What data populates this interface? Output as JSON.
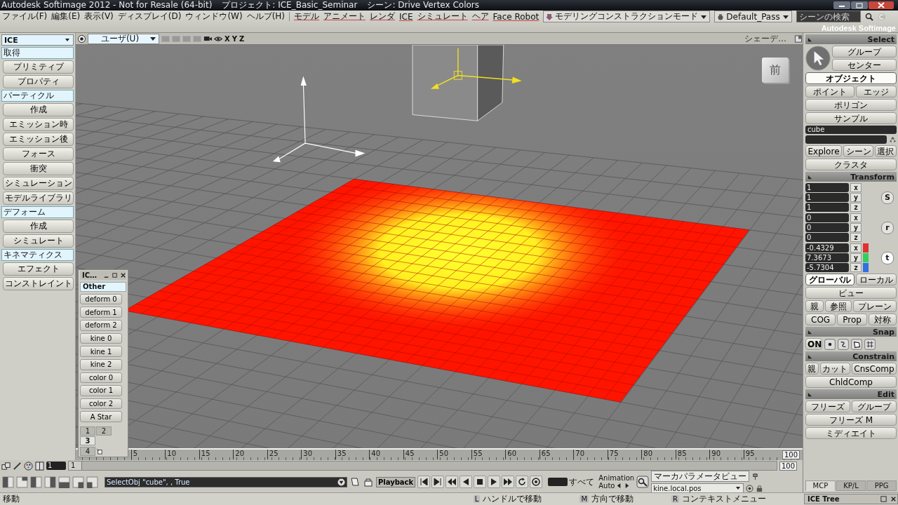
{
  "window": {
    "title": "Autodesk Softimage 2012  - Not for Resale (64-bit)",
    "project": "プロジェクト: ICE_Basic_Seminar",
    "scene": "シーン: Drive Vertex Colors"
  },
  "menu": [
    "ファイル(F)",
    "編集(E)",
    "表示(V)",
    "ディスプレイ(D)",
    "ウィンドウ(W)",
    "ヘルプ(H)"
  ],
  "module_menu": [
    "モデル",
    "アニメート",
    "レンダ",
    "ICE",
    "シミュレート",
    "ヘア",
    "Face Robot"
  ],
  "mode_dropdown": "モデリングコンストラクションモード",
  "pass_dropdown": "Default_Pass",
  "search": {
    "placeholder": "シーンの検索"
  },
  "brand": "Autodesk Softimage",
  "left_panel": {
    "toolbar": "ICE",
    "sections": [
      {
        "title": "取得",
        "buttons": [
          "プリミティブ",
          "プロパティ"
        ]
      },
      {
        "title": "パーティクル",
        "buttons": [
          "作成",
          "エミッション時",
          "エミッション後",
          "フォース",
          "衝突",
          "シミュレーション",
          "モデルライブラリ"
        ]
      },
      {
        "title": "デフォーム",
        "buttons": [
          "作成",
          "シミュレート"
        ]
      },
      {
        "title": "キネマティクス",
        "buttons": [
          "エフェクト",
          "コンストレイント"
        ]
      }
    ]
  },
  "viewport": {
    "camera": "ユーザ(U)",
    "axes": [
      "X",
      "Y",
      "Z"
    ],
    "display_mode": "シェーデ…",
    "nav_cube_face": "前"
  },
  "ice_window": {
    "title": "IC…",
    "tab": "Other",
    "buttons": [
      "deform 0",
      "deform 1",
      "deform 2",
      "kine 0",
      "kine 1",
      "kine 2",
      "color 0",
      "color 1",
      "color 2",
      "A Star"
    ],
    "pages": [
      {
        "label": "1",
        "selected": false
      },
      {
        "label": "2",
        "selected": false
      },
      {
        "label": "3",
        "selected": true
      },
      {
        "label": "4",
        "selected": false
      }
    ]
  },
  "right_panel": {
    "select": {
      "title": "Select",
      "buttons": [
        "グループ",
        "センター"
      ],
      "filters": [
        {
          "label": "オブジェクト",
          "selected": true
        },
        {
          "label": "ポイント",
          "selected": false
        },
        {
          "label": "エッジ",
          "selected": false
        },
        {
          "label": "ポリゴン",
          "selected": false
        }
      ],
      "sample": "サンプル",
      "name_field": "cube",
      "nav": [
        "Explore",
        "シーン",
        "選択",
        "クラスタ"
      ]
    },
    "transform": {
      "title": "Transform",
      "groups": [
        {
          "kind": "scale",
          "key": "S",
          "values": [
            "1",
            "1",
            "1"
          ],
          "axes": [
            {
              "label": "x"
            },
            {
              "label": "y"
            },
            {
              "label": "z"
            }
          ]
        },
        {
          "kind": "rotate",
          "key": "r",
          "values": [
            "0",
            "0",
            "0"
          ],
          "axes": [
            {
              "label": "x"
            },
            {
              "label": "y"
            },
            {
              "label": "z"
            }
          ]
        },
        {
          "kind": "translate",
          "key": "t",
          "values": [
            "-0.4329",
            "7.3673",
            "-5.7304"
          ],
          "axes": [
            {
              "label": "x",
              "color": "#e03030"
            },
            {
              "label": "y",
              "color": "#30d060"
            },
            {
              "label": "z",
              "color": "#3070e0"
            }
          ]
        }
      ],
      "space": [
        {
          "label": "グローバル",
          "selected": true
        },
        {
          "label": "ローカル",
          "selected": false
        },
        {
          "label": "ビュー",
          "selected": false
        }
      ],
      "reference": [
        "親",
        "参照",
        "プレーン"
      ],
      "pivot": [
        "COG",
        "Prop",
        "対称"
      ]
    },
    "snap": {
      "title": "Snap",
      "toggle": "ON"
    },
    "constrain": {
      "title": "Constrain",
      "buttons": [
        "親",
        "カット",
        "CnsComp",
        "ChldComp"
      ]
    },
    "edit": {
      "title": "Edit",
      "buttons": [
        "フリーズ",
        "グループ",
        "フリーズ M",
        "ミディエイト"
      ]
    },
    "tabs": [
      {
        "label": "MCP",
        "selected": true
      },
      {
        "label": "KP/L",
        "selected": false
      },
      {
        "label": "PPG",
        "selected": false
      }
    ]
  },
  "timeline": {
    "ticks": [
      "5",
      "10",
      "15",
      "20",
      "25",
      "30",
      "35",
      "40",
      "45",
      "50",
      "55",
      "60",
      "65",
      "70",
      "75",
      "80",
      "85",
      "90",
      "95"
    ],
    "end": "100",
    "start_frame": "1",
    "range_start": "1",
    "range_end": "100"
  },
  "command_line": "SelectObj \"cube\", , True",
  "playback": {
    "label": "Playback",
    "all": "すべて",
    "animation": "Animation",
    "auto": "Auto",
    "marker_field": "マーカパラメータビュー",
    "parameter_field": "kine.local.pos"
  },
  "status": {
    "text": "移動",
    "hints": [
      {
        "button": "L",
        "text": "ハンドルで移動"
      },
      {
        "button": "M",
        "text": "方向で移動"
      },
      {
        "button": "R",
        "text": "コンテキストメニュー"
      }
    ],
    "ice_tree": "ICE Tree"
  }
}
